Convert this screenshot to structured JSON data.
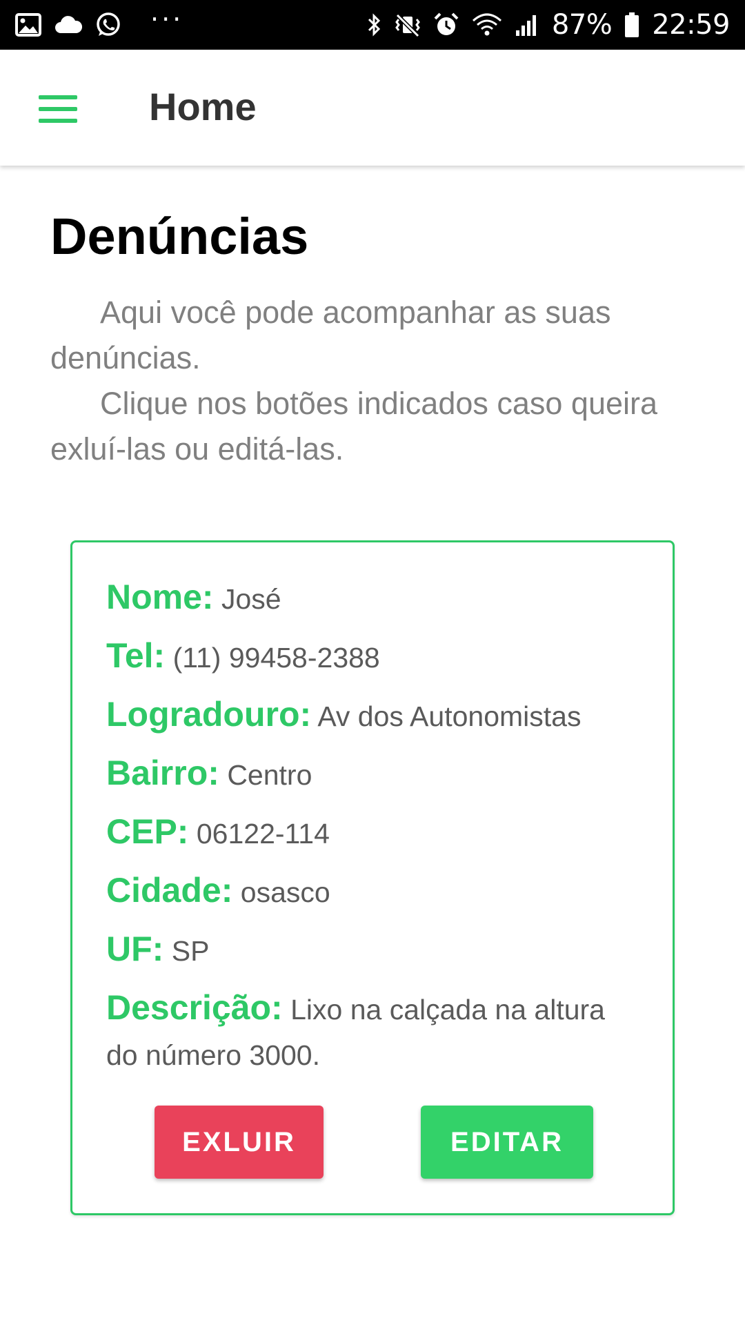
{
  "status_bar": {
    "battery": "87%",
    "time": "22:59",
    "dots": "···",
    "left_icons": [
      "image-icon",
      "cloud-icon",
      "whatsapp-icon"
    ],
    "right_icons": [
      "bluetooth-icon",
      "vibrate-mute-icon",
      "alarm-icon",
      "wifi-icon",
      "signal-icon",
      "battery-icon"
    ]
  },
  "app_bar": {
    "title": "Home",
    "menu_icon": "hamburger-menu-icon"
  },
  "main": {
    "title": "Denúncias",
    "intro": [
      "Aqui você pode acompanhar as suas denúncias.",
      "Clique nos botões indicados caso queira exluí-las ou editá-las."
    ]
  },
  "card": {
    "fields": [
      {
        "label": "Nome:",
        "value": "José"
      },
      {
        "label": "Tel:",
        "value": "(11) 99458-2388"
      },
      {
        "label": "Logradouro:",
        "value": "Av dos Autonomistas"
      },
      {
        "label": "Bairro:",
        "value": "Centro"
      },
      {
        "label": "CEP:",
        "value": "06122-114"
      },
      {
        "label": "Cidade:",
        "value": "osasco"
      },
      {
        "label": "UF:",
        "value": "SP"
      },
      {
        "label": "Descrição:",
        "value": "Lixo na calçada na altura do número 3000."
      }
    ],
    "delete_label": "EXLUIR",
    "edit_label": "EDITAR"
  },
  "colors": {
    "accent": "#2ec866",
    "delete": "#e9425a",
    "edit": "#33d269"
  }
}
